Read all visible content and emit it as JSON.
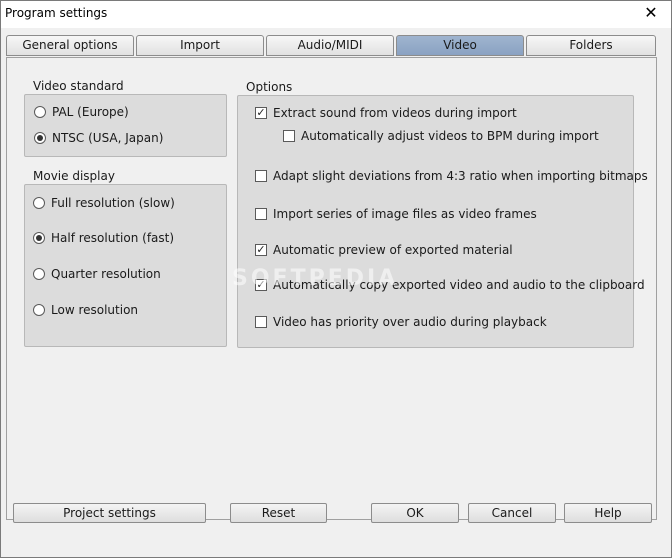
{
  "window": {
    "title": "Program settings",
    "close_glyph": "✕"
  },
  "tabs": [
    {
      "label": "General options",
      "active": false
    },
    {
      "label": "Import",
      "active": false
    },
    {
      "label": "Audio/MIDI",
      "active": false
    },
    {
      "label": "Video",
      "active": true
    },
    {
      "label": "Folders",
      "active": false
    }
  ],
  "video_standard": {
    "label": "Video standard",
    "options": [
      {
        "label": "PAL (Europe)",
        "selected": false
      },
      {
        "label": "NTSC (USA, Japan)",
        "selected": true
      }
    ]
  },
  "movie_display": {
    "label": "Movie display",
    "options": [
      {
        "label": "Full resolution (slow)",
        "selected": false
      },
      {
        "label": "Half resolution (fast)",
        "selected": true
      },
      {
        "label": "Quarter resolution",
        "selected": false
      },
      {
        "label": "Low resolution",
        "selected": false
      }
    ]
  },
  "options": {
    "label": "Options",
    "items": [
      {
        "label": "Extract sound from videos during import",
        "checked": true
      },
      {
        "label": "Automatically adjust videos to BPM during import",
        "checked": false
      },
      {
        "label": "Adapt slight deviations from 4:3 ratio when importing bitmaps",
        "checked": false
      },
      {
        "label": "Import series of image files as video frames",
        "checked": false
      },
      {
        "label": "Automatic preview of exported material",
        "checked": true
      },
      {
        "label": "Automatically copy exported video and audio to the clipboard",
        "checked": true
      },
      {
        "label": "Video has priority over audio during playback",
        "checked": false
      }
    ]
  },
  "buttons": {
    "project_settings": "Project settings",
    "reset": "Reset",
    "ok": "OK",
    "cancel": "Cancel",
    "help": "Help"
  },
  "watermark": "SOFTPEDIA"
}
